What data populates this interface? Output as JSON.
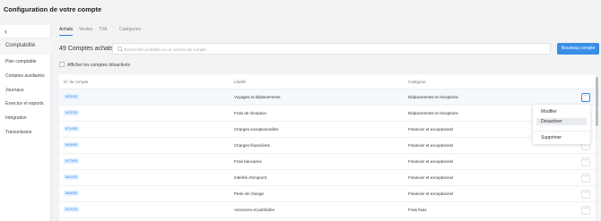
{
  "header": {
    "title": "Configuration de votre compte"
  },
  "sidebar": {
    "back_glyph": "‹",
    "section": "Comptabilité",
    "items": [
      {
        "label": "Plan comptable"
      },
      {
        "label": "Comptes auxiliaires"
      },
      {
        "label": "Journaux"
      },
      {
        "label": "Exercice et exports"
      },
      {
        "label": "Intégration"
      },
      {
        "label": "Transmission"
      }
    ]
  },
  "tabs": [
    {
      "label": "Achats",
      "active": true
    },
    {
      "label": "Ventes",
      "active": false
    },
    {
      "label": "TVA",
      "active": false
    },
    {
      "label": "Catégories",
      "active": false
    }
  ],
  "toolbar": {
    "count": "49 Comptes achats",
    "search_placeholder": "Recherché un libellé ou un numéro de compte",
    "new_button": "Nouveau compte"
  },
  "filter": {
    "show_disabled_label": "Afficher les comptes désactivés",
    "checked": false
  },
  "table": {
    "columns": [
      "N° de compte",
      "Libellé",
      "Catégorie"
    ],
    "rows": [
      {
        "account": "625100",
        "label": "Voyages et déplacements",
        "category": "Déplacements et réceptions"
      },
      {
        "account": "625700",
        "label": "Frais de réception",
        "category": "Déplacements et réceptions"
      },
      {
        "account": "671000",
        "label": "Charges exceptionnelles",
        "category": "Financier et exceptionnel"
      },
      {
        "account": "665000",
        "label": "Charges financières",
        "category": "Financier et exceptionnel"
      },
      {
        "account": "627800",
        "label": "Frais bancaires",
        "category": "Financier et exceptionnel"
      },
      {
        "account": "661100",
        "label": "Intérêts d'emprunt",
        "category": "Financier et exceptionnel"
      },
      {
        "account": "666000",
        "label": "Perte de change",
        "category": "Financier et exceptionnel"
      },
      {
        "account": "623100",
        "label": "Annonces et publicités",
        "category": "Frais fixes"
      }
    ],
    "row_action_glyph": "···"
  },
  "context_menu": {
    "items": [
      "Modifier",
      "Désactiver",
      "Supprimer"
    ],
    "hovered": "Désactiver"
  },
  "colors": {
    "accent": "#3a8ee6",
    "badge_bg": "#e3efff",
    "background": "#f2f3f5"
  }
}
